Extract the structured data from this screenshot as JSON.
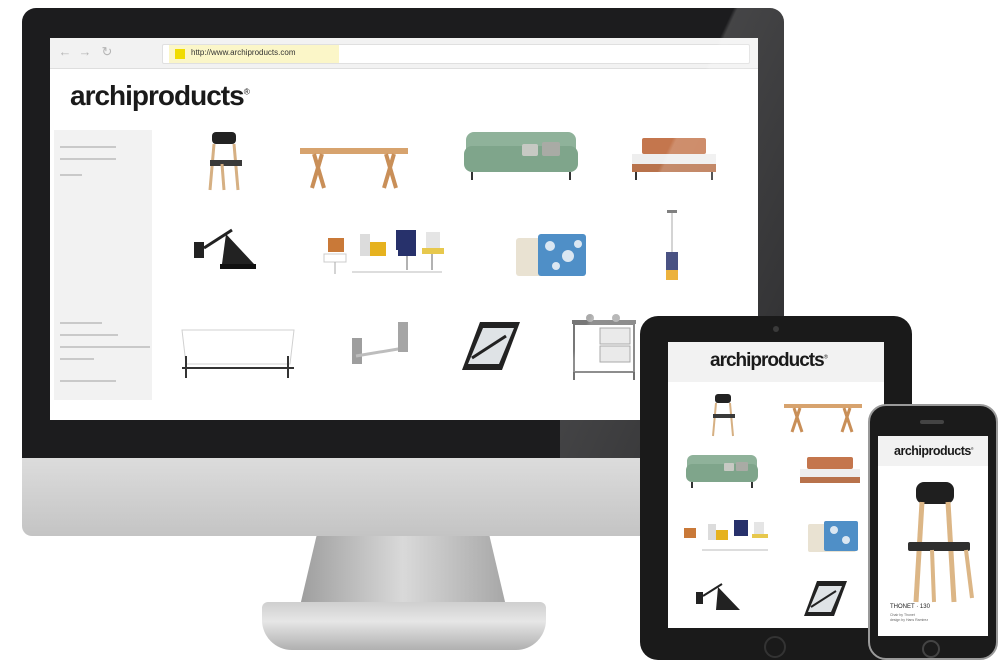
{
  "desktop": {
    "browser": {
      "back_icon": "arrow-left-icon",
      "forward_icon": "arrow-right-icon",
      "reload_icon": "reload-icon",
      "url": "http://www.archiproducts.com"
    },
    "logo": "archiproducts",
    "logo_mark": "®"
  },
  "tablet": {
    "logo": "archiproducts",
    "logo_mark": "®"
  },
  "phone": {
    "logo": "archiproducts",
    "logo_mark": "®",
    "product_name": "THONET · 130",
    "product_byline_1": "Chair by Thonet",
    "product_byline_2": "design by Hans Ramirez"
  },
  "colors": {
    "bezel": "#1c1c1e",
    "sofa_green": "#8fb29a",
    "wood": "#d7a36e",
    "url_highlight": "#fbf6c8",
    "favicon": "#f0dc00"
  }
}
